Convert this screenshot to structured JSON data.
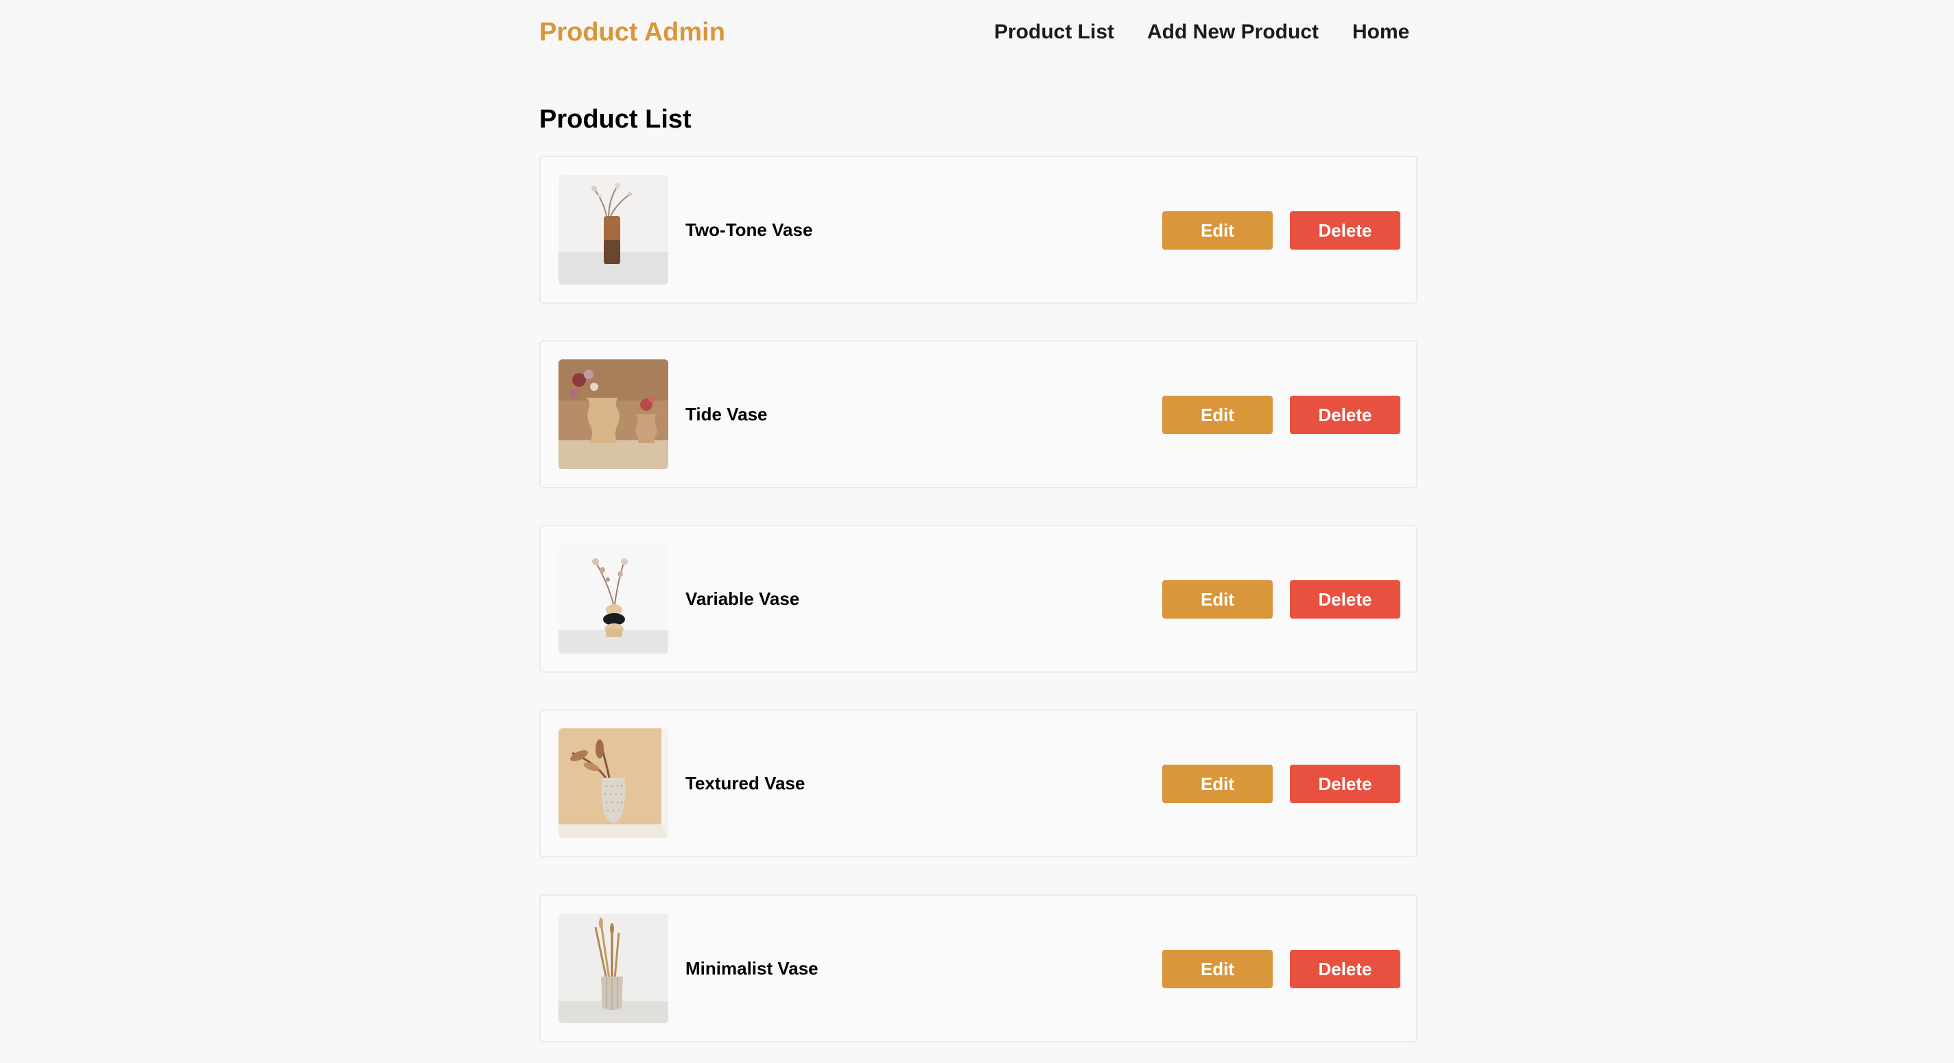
{
  "header": {
    "brand": "Product Admin",
    "nav": [
      {
        "label": "Product List"
      },
      {
        "label": "Add New Product"
      },
      {
        "label": "Home"
      }
    ]
  },
  "main": {
    "title": "Product List",
    "products": [
      {
        "name": "Two-Tone Vase",
        "edit_label": "Edit",
        "delete_label": "Delete",
        "image": "two-tone-vase-photo"
      },
      {
        "name": "Tide Vase",
        "edit_label": "Edit",
        "delete_label": "Delete",
        "image": "tide-vase-photo"
      },
      {
        "name": "Variable Vase",
        "edit_label": "Edit",
        "delete_label": "Delete",
        "image": "variable-vase-photo"
      },
      {
        "name": "Textured Vase",
        "edit_label": "Edit",
        "delete_label": "Delete",
        "image": "textured-vase-photo"
      },
      {
        "name": "Minimalist Vase",
        "edit_label": "Edit",
        "delete_label": "Delete",
        "image": "minimalist-vase-photo"
      }
    ]
  },
  "colors": {
    "brand": "#d9963a",
    "edit_button": "#d9963a",
    "delete_button": "#e8513f",
    "page_background": "#f9f8f6",
    "header_background": "#f7f7f7"
  }
}
